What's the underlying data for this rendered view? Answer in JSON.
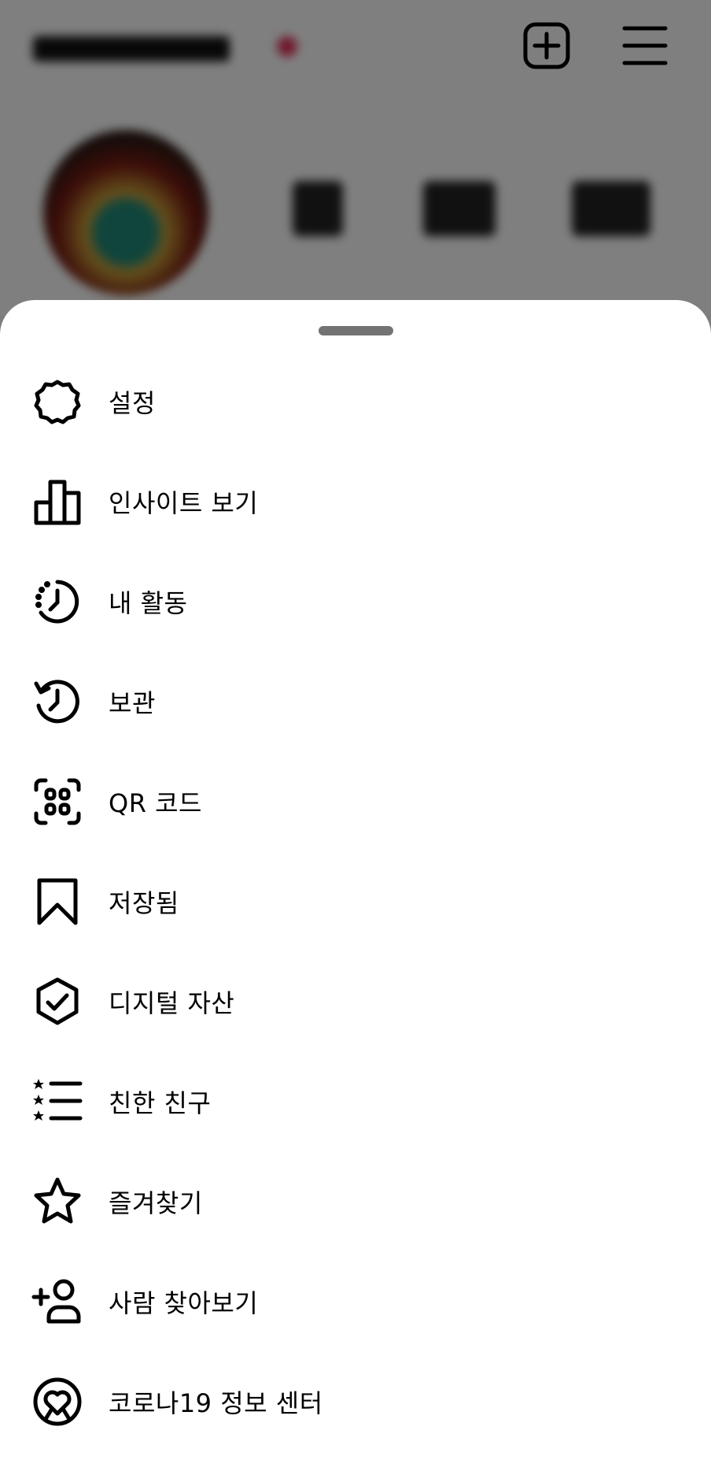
{
  "colors": {
    "sheet_background": "#ffffff",
    "text": "#000000",
    "icon": "#000000",
    "drag_handle": "#737373",
    "scrim": "rgba(0,0,0,0.5)"
  },
  "header": {
    "create_icon": "plus-square-icon",
    "menu_icon": "hamburger-menu-icon"
  },
  "menu": {
    "items": [
      {
        "label": "설정",
        "icon": "gear-icon"
      },
      {
        "label": "인사이트 보기",
        "icon": "bar-chart-icon"
      },
      {
        "label": "내 활동",
        "icon": "activity-clock-icon"
      },
      {
        "label": "보관",
        "icon": "archive-history-icon"
      },
      {
        "label": "QR 코드",
        "icon": "qr-code-icon"
      },
      {
        "label": "저장됨",
        "icon": "bookmark-icon"
      },
      {
        "label": "디지털 자산",
        "icon": "verified-hexagon-icon"
      },
      {
        "label": "친한 친구",
        "icon": "close-friends-list-icon"
      },
      {
        "label": "즐겨찾기",
        "icon": "star-icon"
      },
      {
        "label": "사람 찾아보기",
        "icon": "add-person-icon"
      },
      {
        "label": "코로나19 정보 센터",
        "icon": "covid-heart-icon"
      }
    ]
  }
}
